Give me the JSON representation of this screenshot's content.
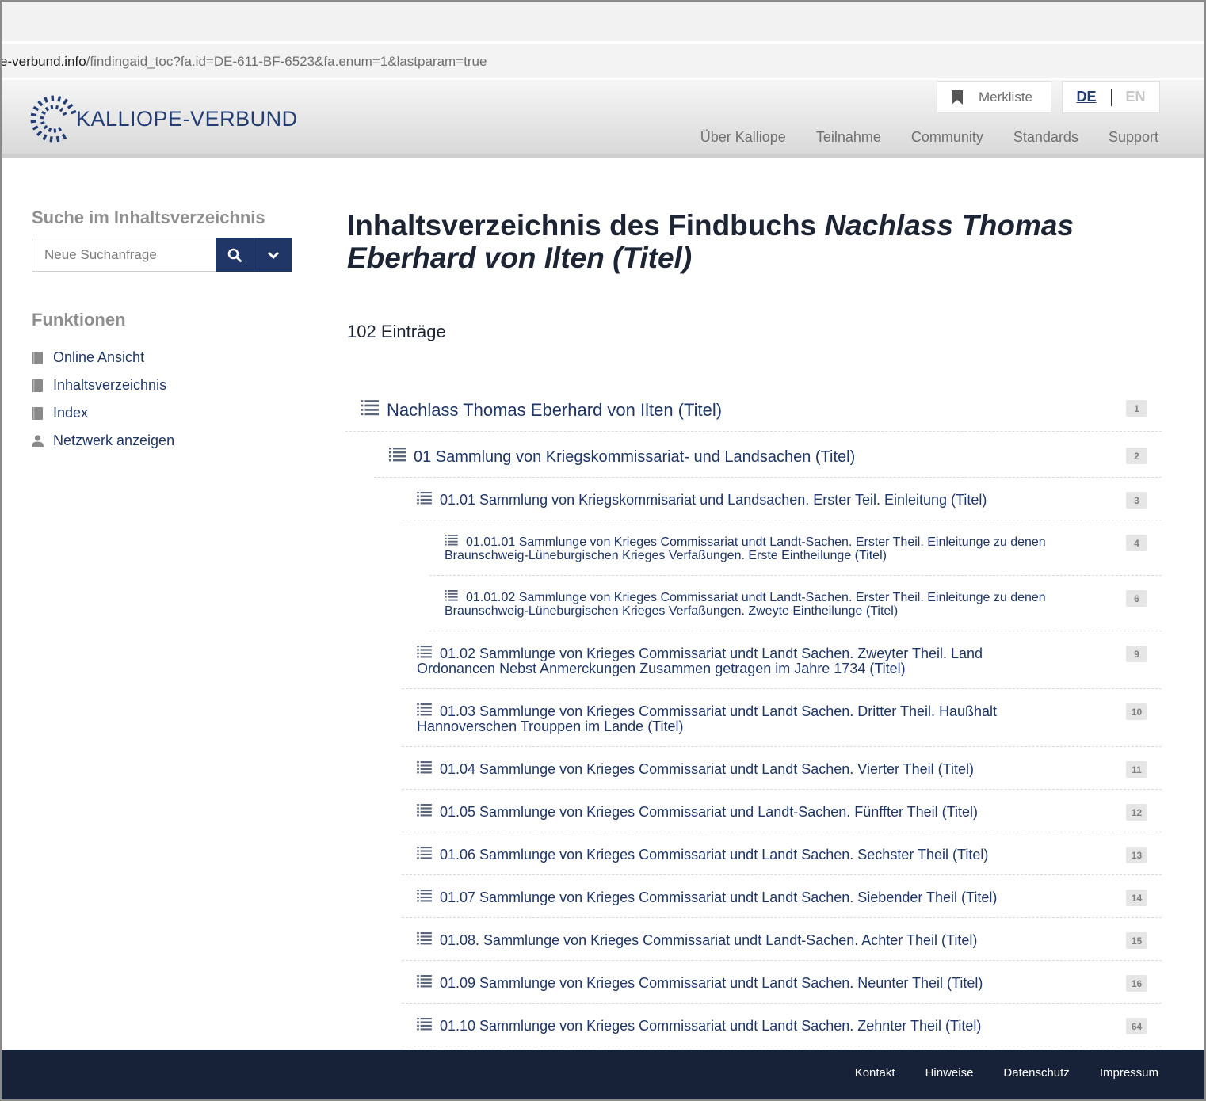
{
  "browser": {
    "url_host": "e-verbund.info",
    "url_path": "/findingaid_toc?fa.id=DE-611-BF-6523&fa.enum=1&lastparam=true"
  },
  "header": {
    "logo_text": "KALLIOPE-VERBUND",
    "merkliste": "Merkliste",
    "lang_de": "DE",
    "lang_en": "EN",
    "nav": [
      "Über Kalliope",
      "Teilnahme",
      "Community",
      "Standards",
      "Support"
    ]
  },
  "sidebar": {
    "search_heading": "Suche im Inhaltsverzeichnis",
    "search_placeholder": "Neue Suchanfrage",
    "functions_heading": "Funktionen",
    "functions": [
      {
        "label": "Online Ansicht",
        "icon": "book-icon"
      },
      {
        "label": "Inhaltsverzeichnis",
        "icon": "book-icon"
      },
      {
        "label": "Index",
        "icon": "book-icon"
      },
      {
        "label": "Netzwerk anzeigen",
        "icon": "person-icon"
      }
    ]
  },
  "main": {
    "title_prefix": "Inhaltsverzeichnis des Findbuchs ",
    "title_italic": "Nachlass Thomas Eberhard von Ilten (Titel)",
    "count": "102 Einträge",
    "toc": [
      {
        "label": "Nachlass Thomas Eberhard von Ilten (Titel)",
        "count": "1"
      },
      {
        "label": "01 Sammlung von Kriegskommissariat- und Landsachen (Titel)",
        "count": "2"
      },
      {
        "label": "01.01 Sammlung von Kriegskommisariat und Landsachen. Erster Teil. Einleitung (Titel)",
        "count": "3"
      },
      {
        "label": "01.01.01 Sammlunge von Krieges Commissariat undt Landt-Sachen. Erster Theil. Einleitunge zu denen Braunschweig-Lüneburgischen Krieges Verfaßungen. Erste Eintheilunge (Titel)",
        "count": "4"
      },
      {
        "label": "01.01.02 Sammlunge von Krieges Commissariat undt Landt-Sachen. Erster Theil. Einleitunge zu denen Braunschweig-Lüneburgischen Krieges Verfaßungen. Zweyte Eintheilunge (Titel)",
        "count": "6"
      },
      {
        "label": "01.02 Sammlunge von Krieges Commissariat undt Landt Sachen. Zweyter Theil. Land Ordonancen Nebst Anmerckungen Zusammen getragen im Jahre 1734 (Titel)",
        "count": "9"
      },
      {
        "label": "01.03 Sammlunge von Krieges Commissariat undt Landt Sachen. Dritter Theil. Haußhalt Hannoverschen Trouppen im Lande (Titel)",
        "count": "10"
      },
      {
        "label": "01.04 Sammlunge von Krieges Commissariat undt Landt Sachen. Vierter Theil (Titel)",
        "count": "11"
      },
      {
        "label": "01.05 Sammlunge von Krieges Commissariat und Landt-Sachen. Fünffter Theil (Titel)",
        "count": "12"
      },
      {
        "label": "01.06 Sammlunge von Krieges Commissariat undt Landt Sachen. Sechster Theil (Titel)",
        "count": "13"
      },
      {
        "label": "01.07 Sammlunge von Krieges Commissariat undt Landt Sachen. Siebender Theil (Titel)",
        "count": "14"
      },
      {
        "label": "01.08. Sammlunge von Krieges Commissariat undt Landt-Sachen. Achter Theil (Titel)",
        "count": "15"
      },
      {
        "label": "01.09 Sammlunge von Krieges Commissariat undt Landt Sachen. Neunter Theil (Titel)",
        "count": "16"
      },
      {
        "label": "01.10 Sammlunge von Krieges Commissariat undt Landt Sachen. Zehnter Theil (Titel)",
        "count": "64"
      }
    ]
  },
  "footer": {
    "links": [
      "Kontakt",
      "Hinweise",
      "Datenschutz",
      "Impressum"
    ]
  },
  "colors": {
    "brand": "#233e74",
    "link": "#1f3667",
    "footer_bg": "#172239",
    "badge_bg": "#e6e6e6"
  }
}
